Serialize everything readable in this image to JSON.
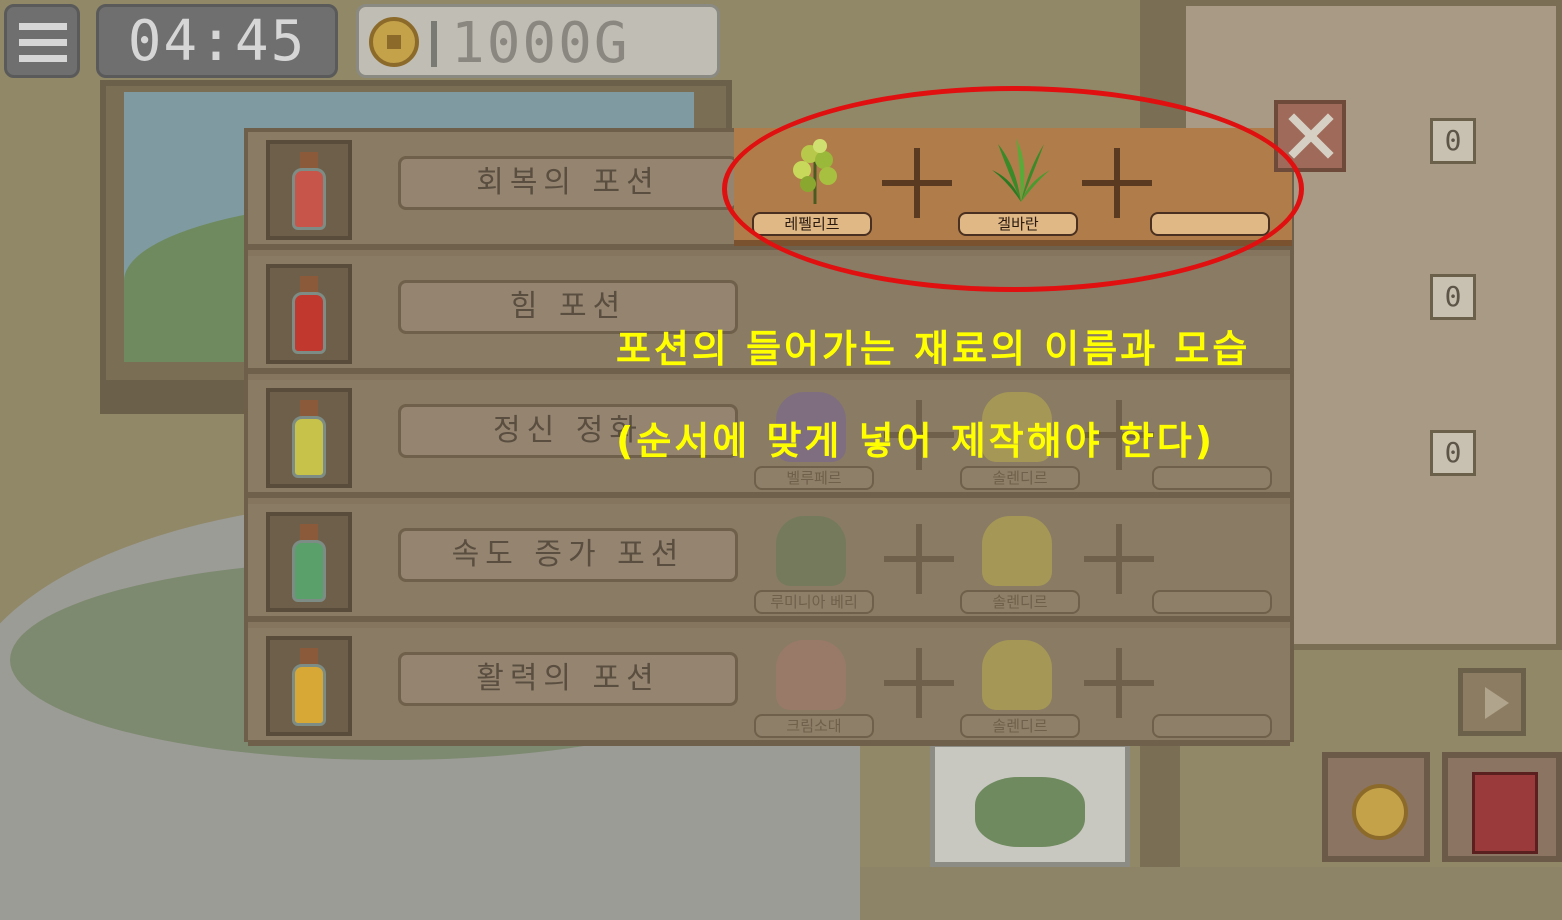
{
  "hud": {
    "time": "04:45",
    "gold": "1000G"
  },
  "recipes": [
    {
      "name": "회복의 포션",
      "ingredients": [
        "레펠리프",
        "겔바란",
        ""
      ],
      "color": "#c8554a"
    },
    {
      "name": "힘 포션",
      "ingredients": [
        "",
        "",
        ""
      ],
      "color": "#c0382e"
    },
    {
      "name": "정신 정화",
      "ingredients": [
        "벨루페르",
        "솔렌디르",
        ""
      ],
      "color": "#c6c24a"
    },
    {
      "name": "속도 증가 포션",
      "ingredients": [
        "루미니아 베리",
        "솔렌디르",
        ""
      ],
      "color": "#5aa06a"
    },
    {
      "name": "활력의 포션",
      "ingredients": [
        "크림소대",
        "솔렌디르",
        ""
      ],
      "color": "#d8a836"
    }
  ],
  "side_counters": [
    "0",
    "0",
    "0"
  ],
  "annotation": {
    "line1": "포션의 들어가는 재료의 이름과 모습",
    "line2": "(순서에 맞게 넣어 제작해야 한다)"
  },
  "colors": {
    "highlight_ring": "#e01010",
    "annotation_text": "#ffff00"
  }
}
